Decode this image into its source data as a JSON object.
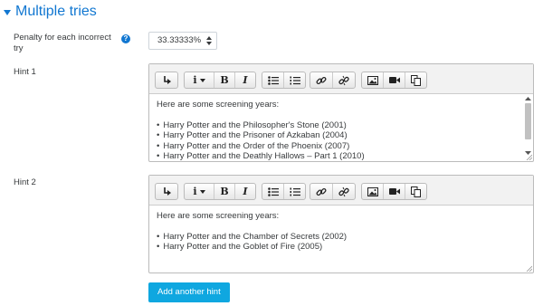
{
  "section": {
    "title": "Multiple tries"
  },
  "penalty": {
    "label": "Penalty for each incorrect try",
    "value": "33.33333%"
  },
  "hints": [
    {
      "label": "Hint 1",
      "intro": "Here are some screening years:",
      "items": [
        "Harry Potter and the Philosopher's Stone (2001)",
        "Harry Potter and the Prisoner of Azkaban (2004)",
        "Harry Potter and the Order of the Phoenix (2007)",
        "Harry Potter and the Deathly Hallows – Part 1 (2010)"
      ]
    },
    {
      "label": "Hint 2",
      "intro": "Here are some screening years:",
      "items": [
        "Harry Potter and the Chamber of Secrets (2002)",
        "Harry Potter and the Goblet of Fire (2005)"
      ]
    }
  ],
  "toolbar": {
    "info_glyph": "i",
    "bold_glyph": "B",
    "italic_glyph": "I"
  },
  "add_hint_label": "Add another hint",
  "colors": {
    "accent": "#1177d1",
    "button": "#0fa7e0"
  }
}
